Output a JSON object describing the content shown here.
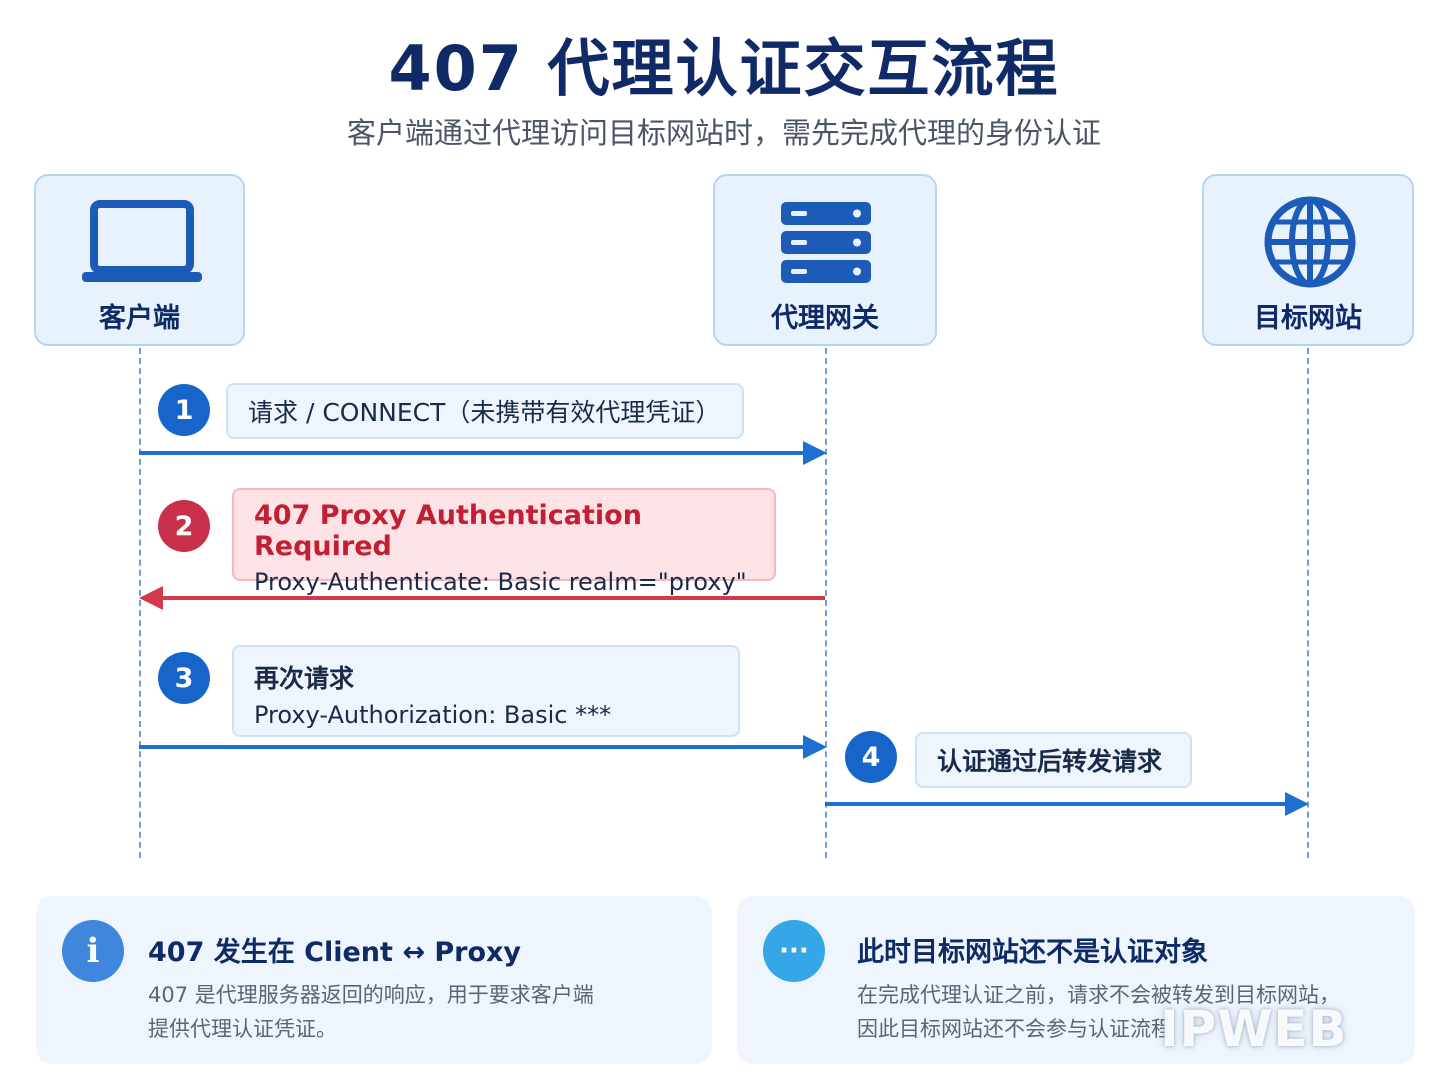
{
  "title": "407 代理认证交互流程",
  "subtitle": "客户端通过代理访问目标网站时，需先完成代理的身份认证",
  "actors": {
    "client": "客户端",
    "proxy": "代理网关",
    "target": "目标网站"
  },
  "steps": [
    {
      "num": "1",
      "text": "请求 / CONNECT（未携带有效代理凭证）"
    },
    {
      "num": "2",
      "title": "407  Proxy Authentication Required",
      "detail": "Proxy-Authenticate:  Basic  realm=\"proxy\""
    },
    {
      "num": "3",
      "title": "再次请求",
      "detail": "Proxy-Authorization:  Basic  ***"
    },
    {
      "num": "4",
      "text": "认证通过后转发请求"
    }
  ],
  "cards": [
    {
      "icon": "i",
      "title": "407 发生在 Client ↔ Proxy",
      "body1": "407 是代理服务器返回的响应，用于要求客户端",
      "body2": "提供代理认证凭证。"
    },
    {
      "icon": "···",
      "title": "此时目标网站还不是认证对象",
      "body1": "在完成代理认证之前，请求不会被转发到目标网站，",
      "body2": "因此目标网站还不会参与认证流程"
    }
  ],
  "watermark": "IPWEB",
  "colors": {
    "navy": "#0f2a66",
    "blue": "#1d6fd0",
    "red": "#d23a4c",
    "panel": "#e8f2fd"
  }
}
